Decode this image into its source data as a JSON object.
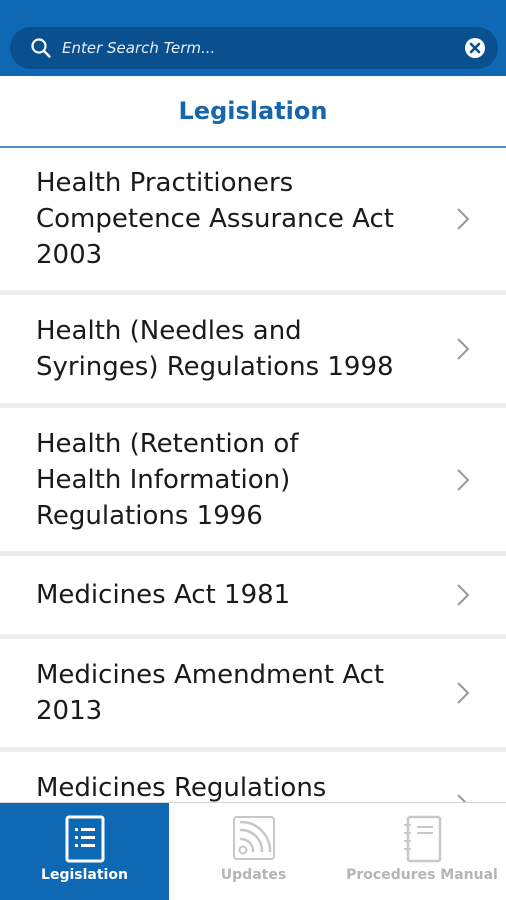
{
  "search": {
    "placeholder": "Enter Search Term..."
  },
  "header": {
    "title": "Legislation"
  },
  "list": {
    "items": [
      {
        "lines": [
          "Health Practitioners",
          "Competence Assurance Act",
          "2003"
        ]
      },
      {
        "lines": [
          "Health (Needles and",
          "Syringes) Regulations 1998"
        ]
      },
      {
        "lines": [
          "Health (Retention of",
          "Health Information)",
          "Regulations 1996"
        ]
      },
      {
        "lines": [
          "Medicines Act 1981"
        ]
      },
      {
        "lines": [
          "Medicines Amendment Act",
          "2013"
        ]
      },
      {
        "lines": [
          "Medicines Regulations"
        ]
      }
    ]
  },
  "nav": {
    "legislation": "Legislation",
    "updates": "Updates",
    "procedures": "Procedures Manual"
  },
  "colors": {
    "brand": "#0f68b4",
    "search_bg": "#0a4f8e",
    "title": "#1566ad",
    "inactive": "#b5b5b5"
  }
}
